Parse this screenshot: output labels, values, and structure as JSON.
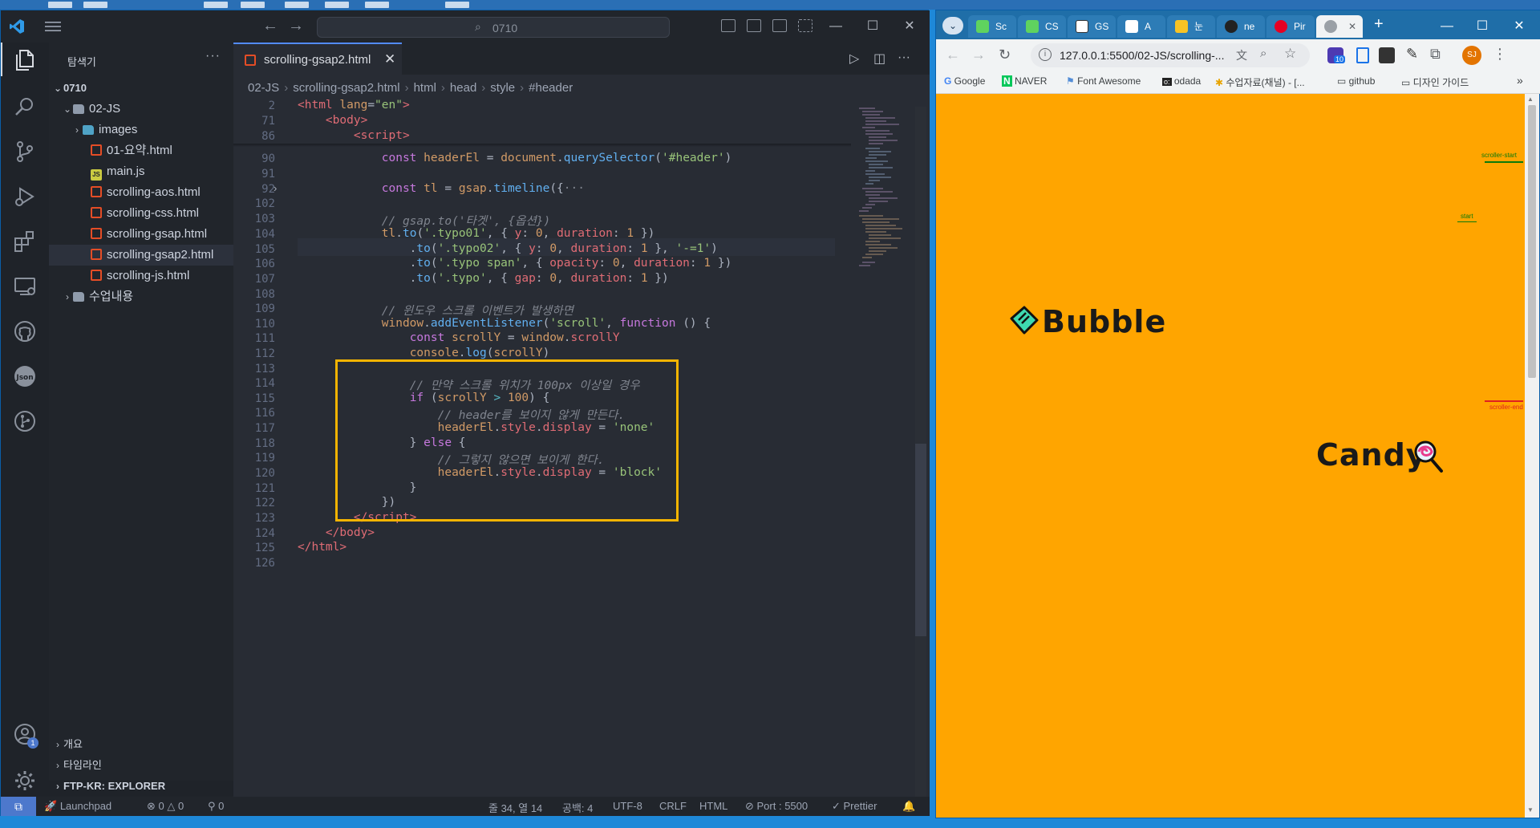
{
  "vscode": {
    "search_text": "0710",
    "sidebar": {
      "title": "탐색기",
      "more": "···",
      "root": "0710",
      "folder": "02-JS",
      "items": [
        {
          "label": "images",
          "type": "folder"
        },
        {
          "label": "01-요약.html",
          "type": "html"
        },
        {
          "label": "main.js",
          "type": "js"
        },
        {
          "label": "scrolling-aos.html",
          "type": "html"
        },
        {
          "label": "scrolling-css.html",
          "type": "html"
        },
        {
          "label": "scrolling-gsap.html",
          "type": "html"
        },
        {
          "label": "scrolling-gsap2.html",
          "type": "html"
        },
        {
          "label": "scrolling-js.html",
          "type": "html"
        }
      ],
      "other_folder": "수업내용",
      "sections": [
        "개요",
        "타임라인",
        "FTP-KR: EXPLORER"
      ]
    },
    "tab": {
      "label": "scrolling-gsap2.html",
      "close": "✕"
    },
    "breadcrumb": [
      "02-JS",
      "scrolling-gsap2.html",
      "html",
      "head",
      "style",
      "#header"
    ],
    "line_numbers": [
      "2",
      "71",
      "86",
      "",
      "90",
      "91",
      "92",
      "102",
      "103",
      "104",
      "105",
      "106",
      "107",
      "108",
      "109",
      "110",
      "111",
      "112",
      "113",
      "114",
      "115",
      "116",
      "117",
      "118",
      "119",
      "120",
      "121",
      "122",
      "123",
      "124",
      "125",
      "126"
    ],
    "status": {
      "launchpad": "Launchpad",
      "errors": "0",
      "warnings": "0",
      "ports": "0",
      "position": "줄 34, 열 14",
      "spaces": "공백: 4",
      "encoding": "UTF-8",
      "eol": "CRLF",
      "language": "HTML",
      "port": "Port : 5500",
      "prettier": "Prettier"
    },
    "account_badge": "1"
  },
  "chrome": {
    "tabs": [
      "Sc",
      "CS",
      "GS",
      "A",
      "눈",
      "ne",
      "Pir",
      ""
    ],
    "new_tab": "+",
    "url": "127.0.0.1:5500/02-JS/scrolling-...",
    "extension_badge": "10",
    "avatar": "SJ",
    "bookmarks": [
      "Google",
      "NAVER",
      "Font Awesome",
      "odada",
      "수업자료(채널) - [...",
      "github",
      "디자인 가이드"
    ],
    "page": {
      "logo1": "Bubble",
      "logo2": "Candy",
      "marker_scroller_start": "scroller-start",
      "marker_start": "start",
      "marker_scroller_end": "scroller-end",
      "bg_color": "#ffa500"
    }
  }
}
